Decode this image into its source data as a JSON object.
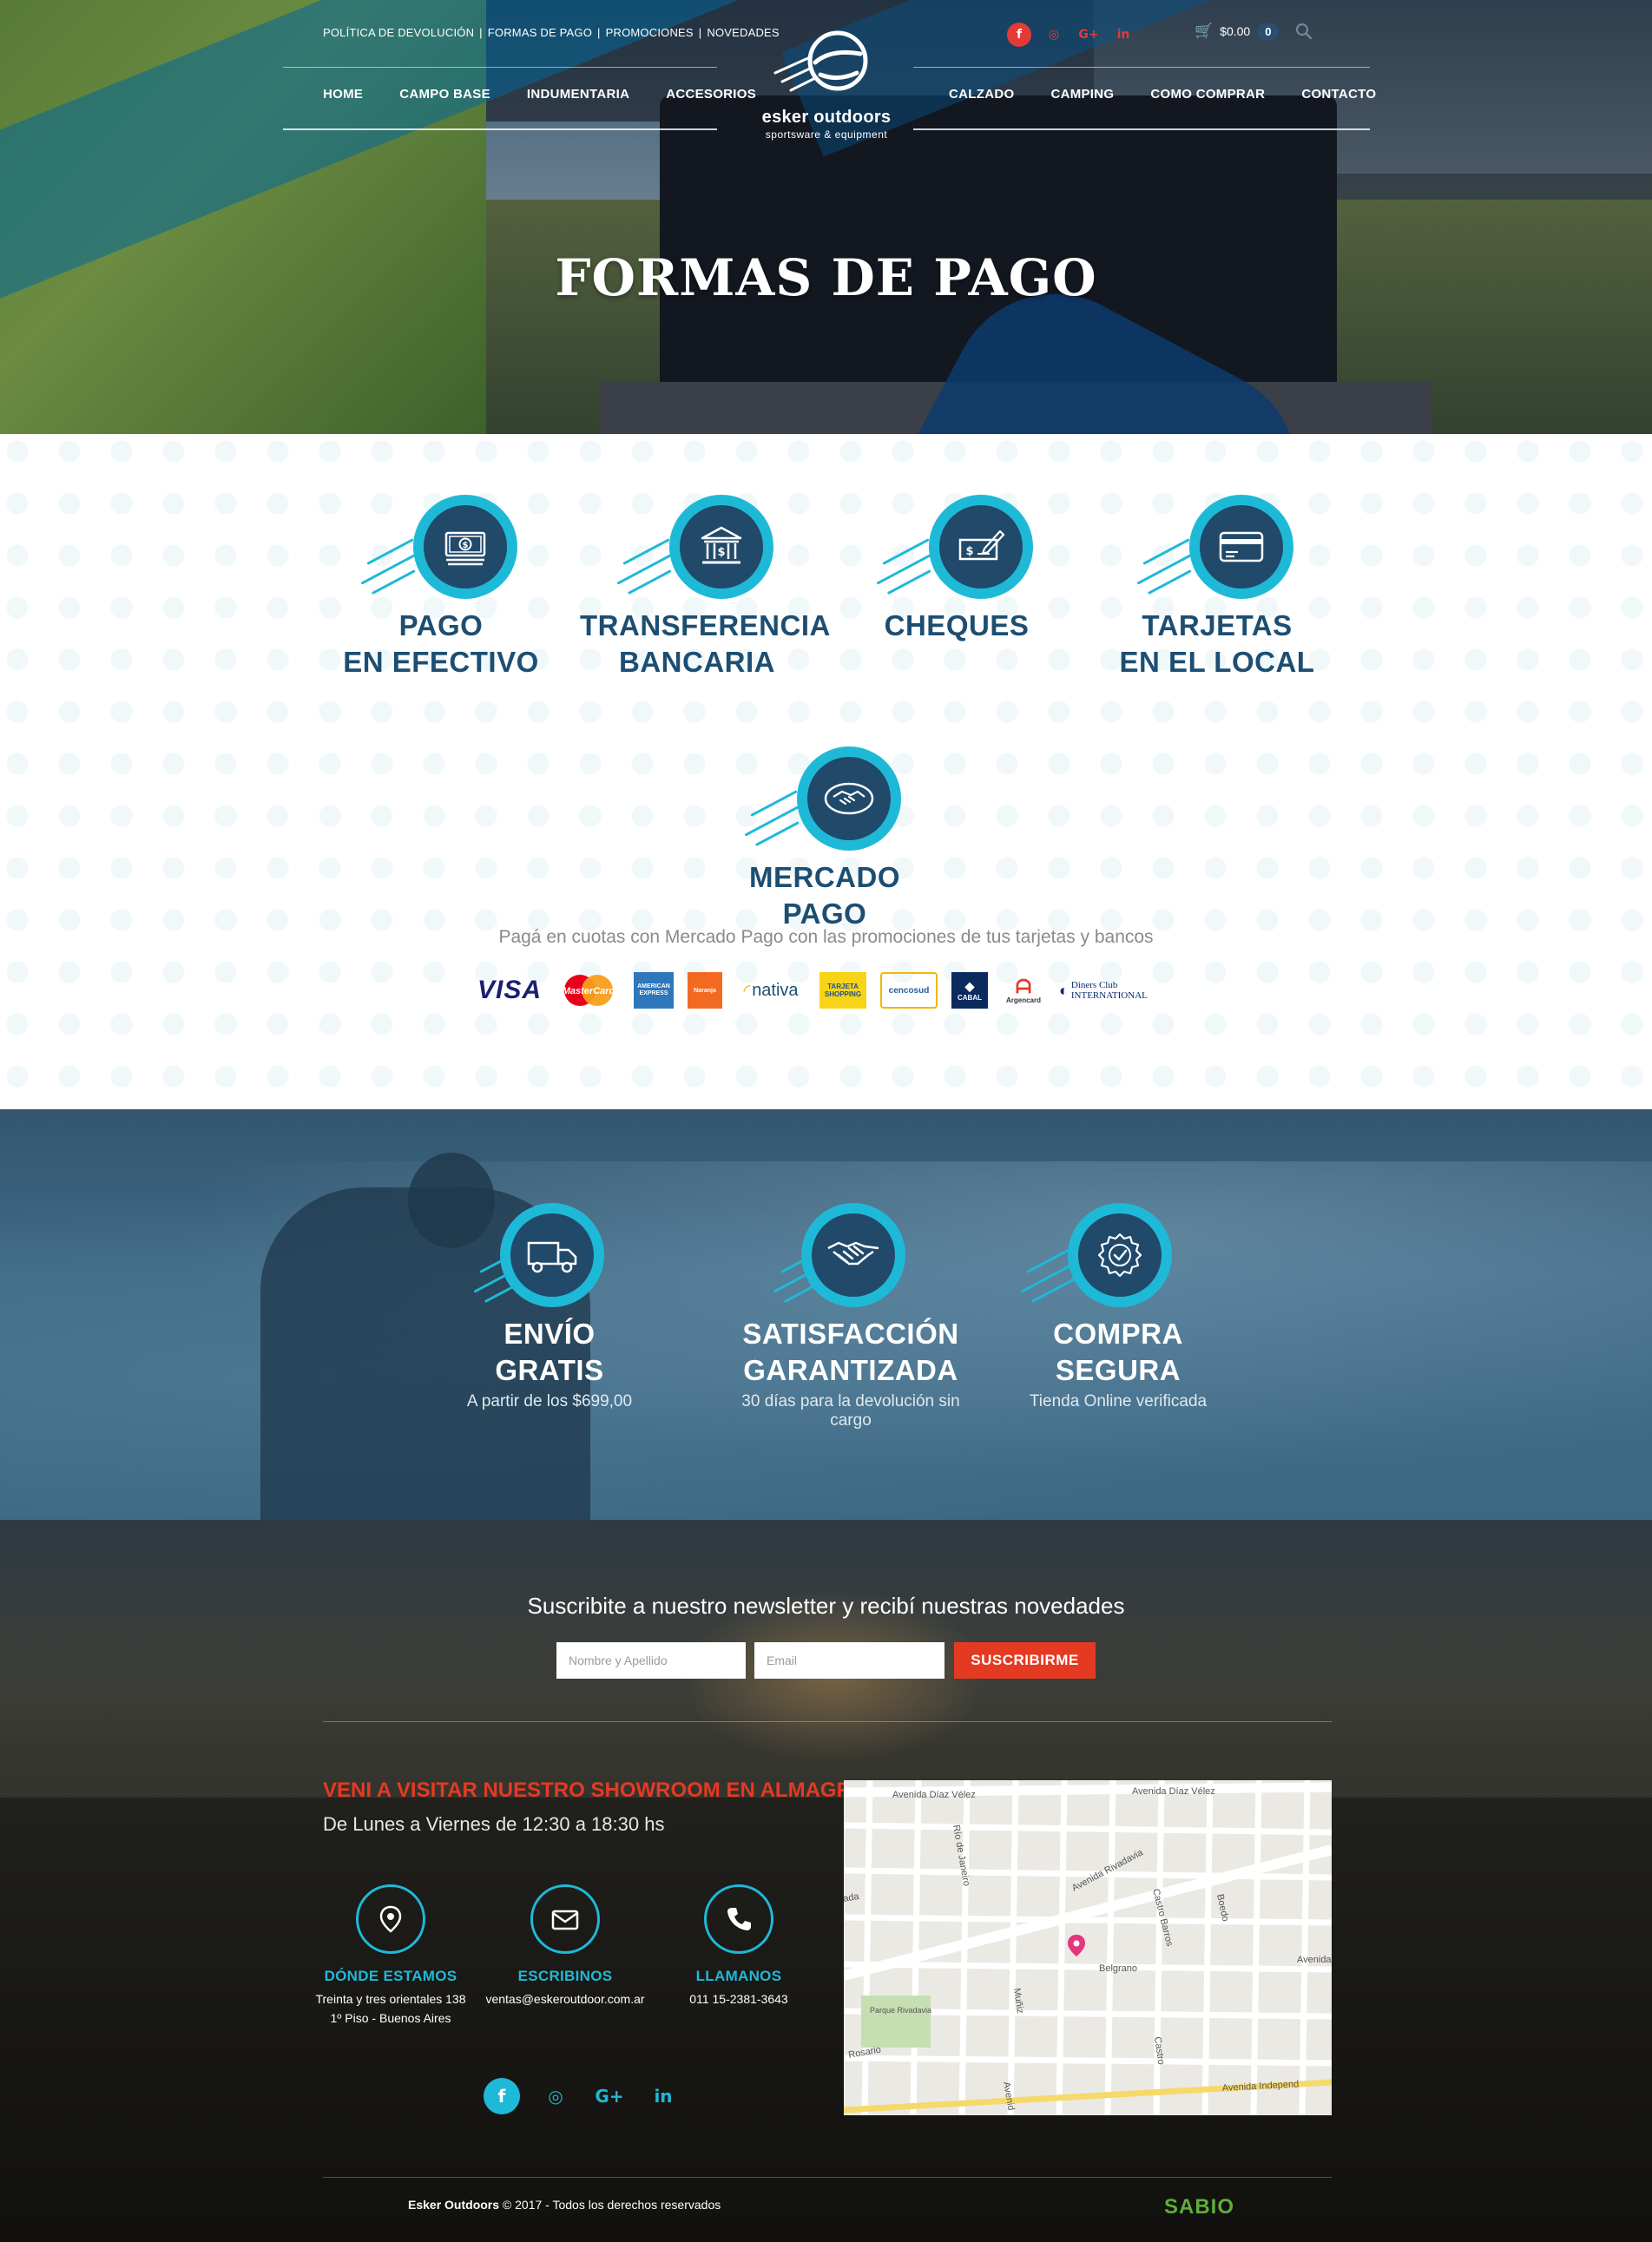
{
  "header": {
    "util_links": [
      "POLÍTICA DE DEVOLUCIÓN",
      "FORMAS DE PAGO",
      "PROMOCIONES",
      "NOVEDADES"
    ],
    "social": [
      {
        "name": "facebook",
        "glyph": "f"
      },
      {
        "name": "instagram",
        "glyph": "◎"
      },
      {
        "name": "google-plus",
        "glyph": "G+"
      },
      {
        "name": "linkedin",
        "glyph": "in"
      }
    ],
    "cart_total": "$0.00",
    "cart_count": "0",
    "nav_left": [
      "HOME",
      "CAMPO BASE",
      "INDUMENTARIA",
      "ACCESORIOS"
    ],
    "nav_right": [
      "CALZADO",
      "CAMPING",
      "COMO COMPRAR",
      "CONTACTO"
    ],
    "logo_brand": "esker outdoors",
    "logo_tagline": "sportsware & equipment"
  },
  "hero": {
    "title": "FORMAS DE PAGO"
  },
  "payments": {
    "methods": [
      {
        "line1": "PAGO",
        "line2": "EN EFECTIVO",
        "icon": "cash-icon"
      },
      {
        "line1": "TRANSFERENCIA",
        "line2": "BANCARIA",
        "icon": "bank-icon"
      },
      {
        "line1": "CHEQUES",
        "line2": "",
        "icon": "check-icon"
      },
      {
        "line1": "TARJETAS",
        "line2": "EN EL LOCAL",
        "icon": "credit-card-icon"
      },
      {
        "line1": "MERCADO PAGO",
        "line2": "",
        "icon": "handshake-icon"
      }
    ],
    "mp_description": "Pagá en cuotas con Mercado Pago con las promociones de tus tarjetas y bancos",
    "cards": [
      "VISA",
      "MasterCard",
      "AMERICAN EXPRESS",
      "Naranja",
      "nativa",
      "TARJETA SHOPPING",
      "cencosud",
      "CABAL",
      "Argencard",
      "Diners Club INTERNATIONAL"
    ]
  },
  "benefits": [
    {
      "line1": "ENVÍO",
      "line2": "GRATIS",
      "sub": "A partir de los $699,00",
      "icon": "truck-icon"
    },
    {
      "line1": "SATISFACCIÓN",
      "line2": "GARANTIZADA",
      "sub": "30 días para la devolución sin cargo",
      "icon": "handshake-icon"
    },
    {
      "line1": "COMPRA",
      "line2": "SEGURA",
      "sub": "Tienda Online verificada",
      "icon": "verified-badge-icon"
    }
  ],
  "footer": {
    "newsletter_title": "Suscribite a nuestro newsletter y recibí nuestras novedades",
    "name_placeholder": "Nombre y Apellido",
    "email_placeholder": "Email",
    "subscribe_label": "SUSCRIBIRME",
    "showroom_title": "VENI A VISITAR NUESTRO SHOWROOM EN ALMAGRO",
    "showroom_hours": "De Lunes a Viernes de 12:30 a 18:30 hs",
    "contacts": [
      {
        "title": "DÓNDE ESTAMOS",
        "line1": "Treinta y tres orientales 138",
        "line2": "1º Piso - Buenos Aires",
        "icon": "location-pin-icon"
      },
      {
        "title": "ESCRIBINOS",
        "line1": "ventas@eskeroutdoor.com.ar",
        "line2": "",
        "icon": "envelope-icon"
      },
      {
        "title": "LLAMANOS",
        "line1": "011 15-2381-3643",
        "line2": "",
        "icon": "phone-icon"
      }
    ],
    "map_labels": {
      "diaz_velez_1": "Avenida Díaz Vélez",
      "diaz_velez_2": "Avenida Díaz Vélez",
      "rio_janeiro": "Río de Janeiro",
      "rivadavia": "Avenida Rivadavia",
      "castro_barros": "Castro Barros",
      "boedo": "Boedo",
      "belgrano": "Belgrano",
      "avenida": "Avenida",
      "parque": "Parque Rivadavia",
      "rosario": "Rosario",
      "muniz": "Muñiz",
      "castro": "Castro",
      "independencia": "Avenida Independ",
      "avenida2": "Avenid",
      "ada": "ada"
    },
    "copyright_brand": "Esker Outdoors",
    "copyright_rest": " © 2017 - Todos los derechos reservados",
    "credit": "SABIO"
  },
  "colors": {
    "accent_cyan": "#1fb9d8",
    "navy": "#21496a",
    "title_blue": "#1d4e72",
    "red": "#e53a22",
    "sabio_green": "#5fae3a"
  }
}
